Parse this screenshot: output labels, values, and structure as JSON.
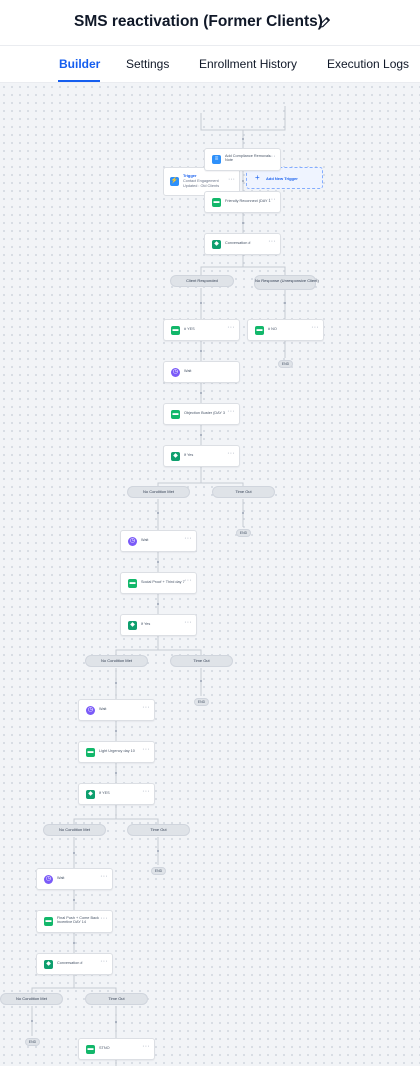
{
  "header": {
    "title": "SMS reactivation (Former Clients)",
    "edit_icon": "pencil-icon"
  },
  "tabs": [
    {
      "label": "Builder",
      "active": true
    },
    {
      "label": "Settings",
      "active": false
    },
    {
      "label": "Enrollment History",
      "active": false
    },
    {
      "label": "Execution Logs",
      "active": false
    }
  ],
  "colors": {
    "accent": "#155eef",
    "sms_icon": "#12b76a",
    "wait_icon": "#7a5af8",
    "trigger_icon": "#2e90fa"
  },
  "workflow": {
    "trigger": {
      "title": "Trigger",
      "subtitle": "Contact Engagement Updated : Old Clients",
      "icon": "trigger-icon"
    },
    "add_trigger": {
      "label": "Add New Trigger",
      "icon": "plus-icon"
    },
    "steps": {
      "compliance": "Add Compliance Removals Note",
      "sms1": "Friendly Reconnect (DAY 1",
      "cond1": "Conversation #",
      "yes_sms": "# YES",
      "no_sms": "# NO",
      "wait1": "Wait",
      "objection": "Objection Buster (DAY 3",
      "cond2": "If Yes",
      "wait2": "Wait",
      "social": "Social Proof + Third day 7",
      "cond3": "If Yes",
      "wait3": "Wait",
      "urgency": "Light Urgency day 10",
      "cond4": "If YES",
      "wait4": "Wait",
      "final": "Final Push + Come Back Incentive DAY 14",
      "cond5": "Conversation #",
      "stop": "STNO"
    },
    "branches": {
      "responded": "Client Responded",
      "no_response": "No Response (Unresponsive Client)",
      "no_condition": "No Condition Met",
      "timeout": "Time Out"
    },
    "end_label": "END"
  }
}
